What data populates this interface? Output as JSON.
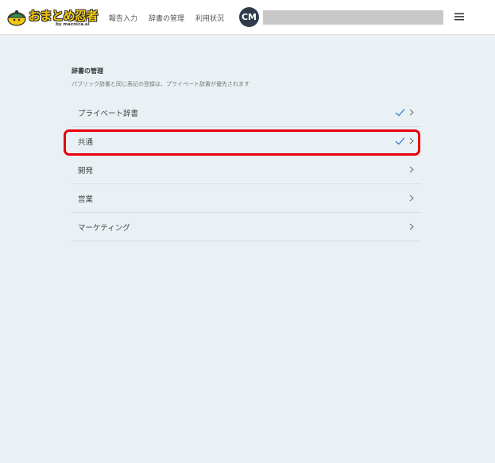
{
  "header": {
    "logo_text": "おまとめ忍者",
    "logo_sub": "by macnica.ai",
    "nav": [
      "報告入力",
      "辞書の管理",
      "利用状況"
    ],
    "avatar_initials": "CM"
  },
  "main": {
    "title": "辞書の管理",
    "description": "パブリック辞書と同じ表記の登録は、プライベート辞書が優先されます",
    "items": [
      {
        "label": "プライベート辞書",
        "checked": true
      },
      {
        "label": "共通",
        "checked": true
      },
      {
        "label": "開発",
        "checked": false
      },
      {
        "label": "営業",
        "checked": false
      },
      {
        "label": "マーケティング",
        "checked": false
      }
    ]
  },
  "colors": {
    "accent": "#3a7bd5",
    "highlight": "#e8000b",
    "background": "#e9f1f5"
  }
}
